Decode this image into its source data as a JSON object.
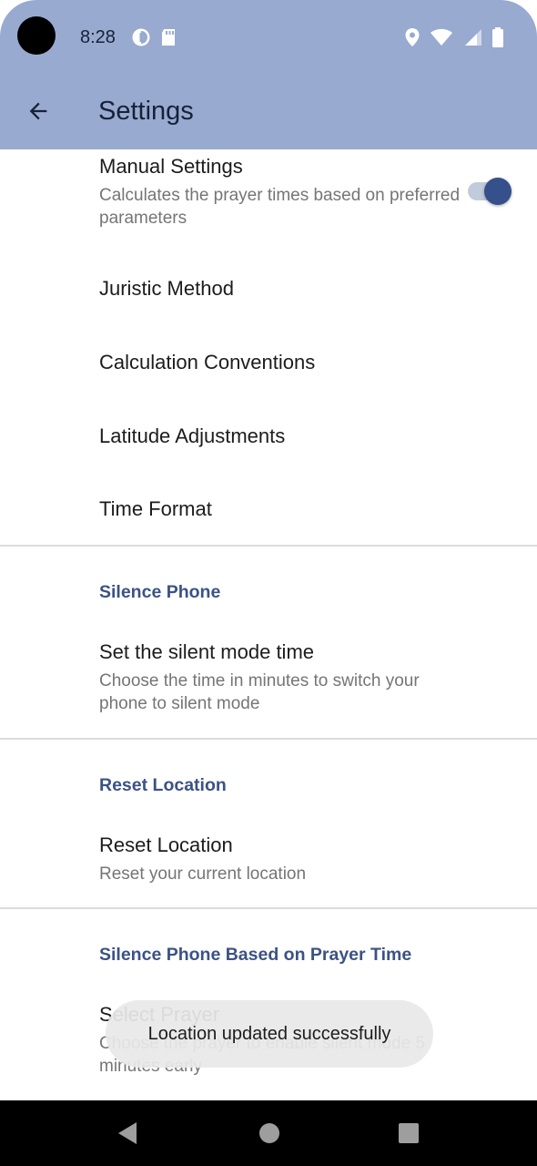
{
  "status_bar": {
    "time": "8:28",
    "left_icons": [
      "data-saver-icon",
      "sd-card-icon"
    ],
    "right_icons": [
      "location-icon",
      "wifi-icon",
      "signal-icon",
      "battery-icon"
    ],
    "background": "#98aacf"
  },
  "app_bar": {
    "title": "Settings",
    "back_icon": "arrow-back-icon"
  },
  "preferences": {
    "manual_settings": {
      "title": "Manual Settings",
      "summary": "Calculates the prayer times based on preferred parameters",
      "toggle_on": true
    },
    "juristic_method": {
      "title": "Juristic Method"
    },
    "calculation_conventions": {
      "title": "Calculation Conventions"
    },
    "latitude_adjustments": {
      "title": "Latitude Adjustments"
    },
    "time_format": {
      "title": "Time Format"
    }
  },
  "sections": {
    "silence_phone": {
      "header": "Silence Phone",
      "item_title": "Set the silent mode time",
      "item_summary": "Choose the time in minutes to switch your phone to silent mode"
    },
    "reset_location": {
      "header": "Reset Location",
      "item_title": "Reset Location",
      "item_summary": "Reset your current location"
    },
    "silence_by_prayer": {
      "header": "Silence Phone Based on Prayer Time",
      "item_title": "Select Prayer",
      "item_summary": "Choose the prayer to enable silent mode 5 minutes early"
    }
  },
  "toast": {
    "message": "Location updated successfully"
  },
  "nav_bar": {
    "back_icon": "nav-back-icon",
    "home_icon": "nav-home-icon",
    "recents_icon": "nav-recents-icon"
  },
  "colors": {
    "accent": "#35508a",
    "section_header": "#3b5284",
    "app_bar": "#98aacf"
  }
}
